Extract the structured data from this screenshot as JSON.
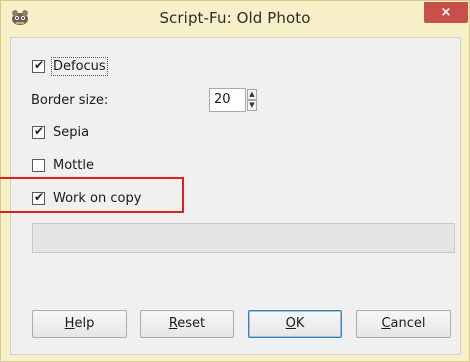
{
  "window": {
    "title": "Script-Fu: Old Photo",
    "close_label": "×",
    "app_icon": "gimp-icon"
  },
  "options": {
    "defocus": {
      "label": "Defocus",
      "checked": true
    },
    "border_size": {
      "label": "Border size:",
      "value": "20"
    },
    "sepia": {
      "label": "Sepia",
      "checked": true
    },
    "mottle": {
      "label": "Mottle",
      "checked": false
    },
    "work_on_copy": {
      "label": "Work on copy",
      "checked": true
    }
  },
  "progress": {
    "value": 0
  },
  "buttons": {
    "help": {
      "mnemonic": "H",
      "rest": "elp"
    },
    "reset": {
      "mnemonic": "R",
      "rest": "eset"
    },
    "ok": {
      "mnemonic": "O",
      "rest": "K"
    },
    "cancel": {
      "mnemonic": "C",
      "rest": "ancel"
    }
  },
  "colors": {
    "highlight": "#e0201c",
    "title_bar": "#f8f0c8",
    "close_button": "#c9504a"
  }
}
